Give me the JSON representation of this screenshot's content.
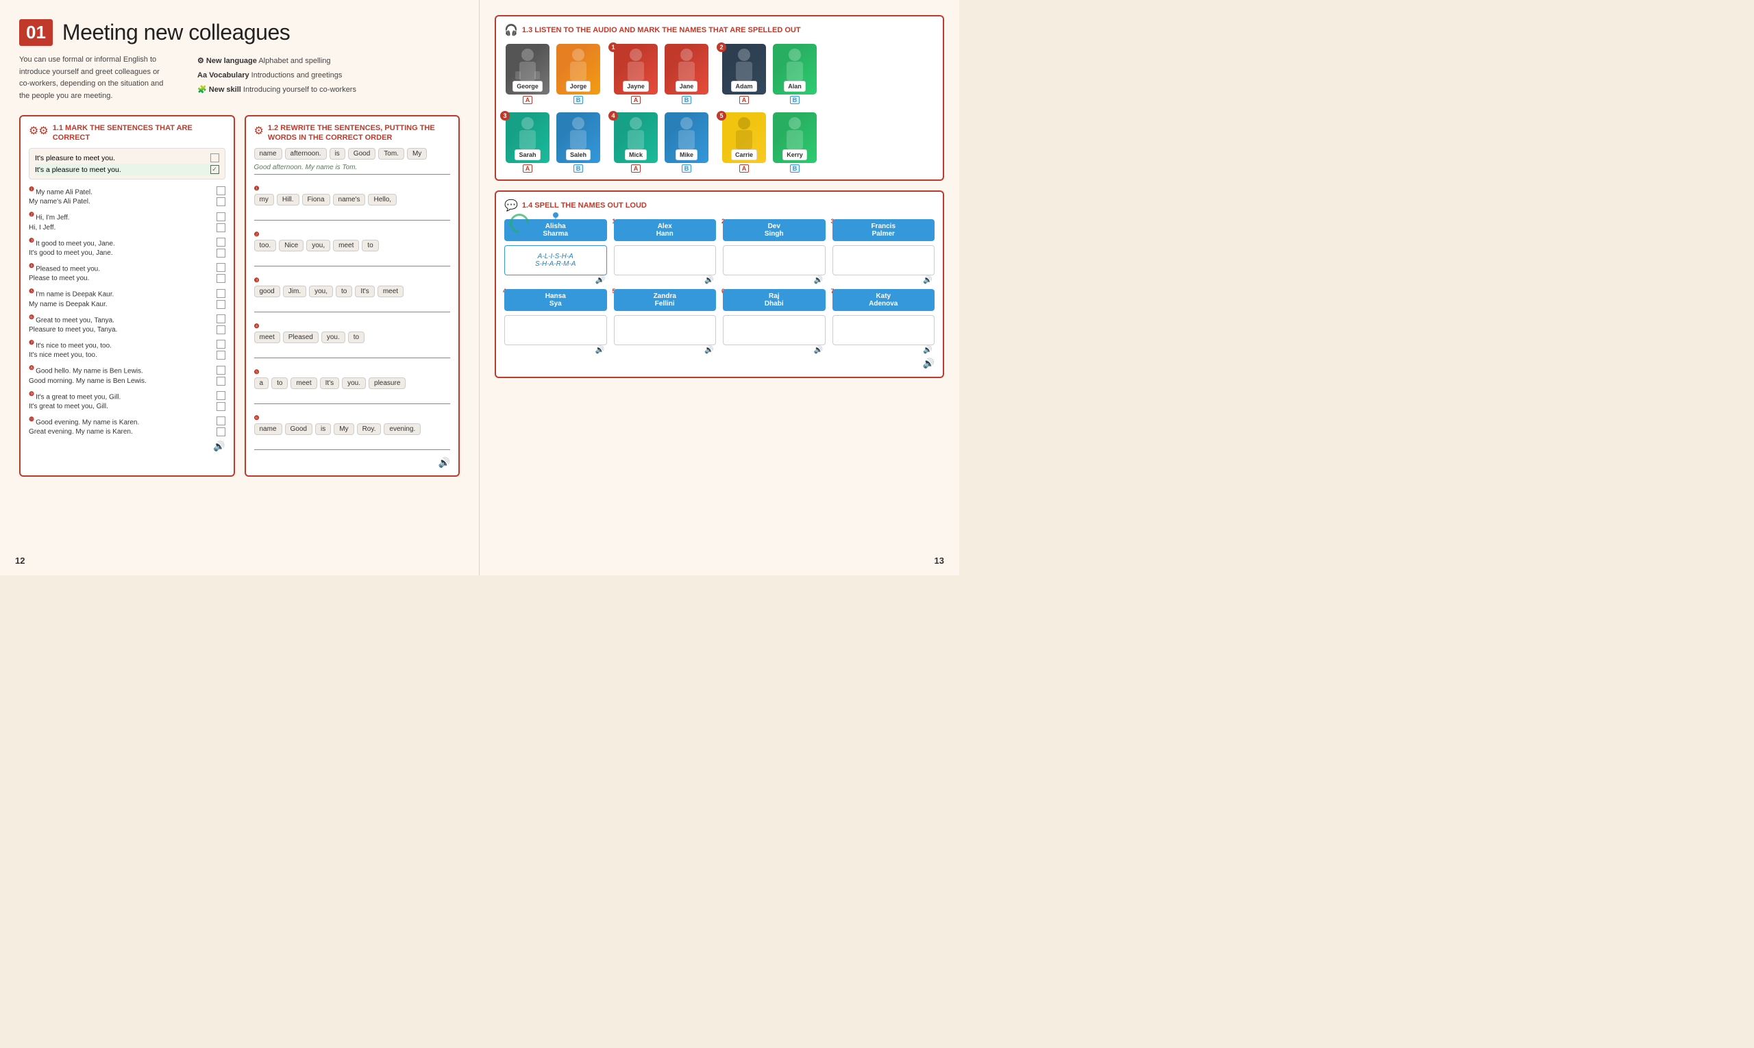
{
  "left": {
    "page_num": "12",
    "lesson_num": "01",
    "lesson_title": "Meeting new colleagues",
    "intro_desc": "You can use formal or informal English to introduce yourself and greet colleagues or co-workers, depending on the situation and the people you are meeting.",
    "skills": [
      {
        "icon": "⚙",
        "label": "New language",
        "detail": "Alphabet and spelling"
      },
      {
        "icon": "Aa",
        "label": "Vocabulary",
        "detail": "Introductions and greetings"
      },
      {
        "icon": "🧩",
        "label": "New skill",
        "detail": "Introducing yourself to co-workers"
      }
    ],
    "ex1": {
      "num": "1.1",
      "title": "MARK THE SENTENCES THAT ARE CORRECT",
      "example_lines": [
        {
          "text": "It's pleasure to meet you.",
          "correct": false
        },
        {
          "text": "It's a pleasure to meet you.",
          "correct": true
        }
      ],
      "pairs": [
        {
          "num": "1",
          "lines": [
            {
              "text": "My name Ali Patel.",
              "correct": false
            },
            {
              "text": "My name's Ali Patel.",
              "correct": false
            }
          ]
        },
        {
          "num": "2",
          "lines": [
            {
              "text": "Hi, I'm Jeff.",
              "correct": false
            },
            {
              "text": "Hi, I Jeff.",
              "correct": false
            }
          ]
        },
        {
          "num": "3",
          "lines": [
            {
              "text": "It good to meet you, Jane.",
              "correct": false
            },
            {
              "text": "It's good to meet you, Jane.",
              "correct": false
            }
          ]
        },
        {
          "num": "4",
          "lines": [
            {
              "text": "Pleased to meet you.",
              "correct": false
            },
            {
              "text": "Please to meet you.",
              "correct": false
            }
          ]
        },
        {
          "num": "5",
          "lines": [
            {
              "text": "I'm name is Deepak Kaur.",
              "correct": false
            },
            {
              "text": "My name is Deepak Kaur.",
              "correct": false
            }
          ]
        },
        {
          "num": "6",
          "lines": [
            {
              "text": "Great to meet you, Tanya.",
              "correct": false
            },
            {
              "text": "Pleasure to meet you, Tanya.",
              "correct": false
            }
          ]
        },
        {
          "num": "7",
          "lines": [
            {
              "text": "It's nice to meet you, too.",
              "correct": false
            },
            {
              "text": "It's nice meet you, too.",
              "correct": false
            }
          ]
        },
        {
          "num": "8",
          "lines": [
            {
              "text": "Good hello. My name is Ben Lewis.",
              "correct": false
            },
            {
              "text": "Good morning. My name is Ben Lewis.",
              "correct": false
            }
          ]
        },
        {
          "num": "9",
          "lines": [
            {
              "text": "It's a great to meet you, Gill.",
              "correct": false
            },
            {
              "text": "It's great to meet you, Gill.",
              "correct": false
            }
          ]
        },
        {
          "num": "10",
          "lines": [
            {
              "text": "Good evening. My name is Karen.",
              "correct": false
            },
            {
              "text": "Great evening. My name is Karen.",
              "correct": false
            }
          ]
        }
      ]
    },
    "ex2": {
      "num": "1.2",
      "title": "REWRITE THE SENTENCES, PUTTING THE WORDS IN THE CORRECT ORDER",
      "example_chips": [
        "name",
        "afternoon.",
        "is",
        "Good",
        "Tom.",
        "My"
      ],
      "example_answer": "Good afternoon. My name is Tom.",
      "rewrites": [
        {
          "num": "1",
          "chips": [
            "my",
            "Hill.",
            "Fiona",
            "name's",
            "Hello,"
          ],
          "answer": ""
        },
        {
          "num": "2",
          "chips": [
            "too.",
            "Nice",
            "you,",
            "meet",
            "to"
          ],
          "answer": ""
        },
        {
          "num": "3",
          "chips": [
            "good",
            "Jim.",
            "you,",
            "to",
            "It's",
            "meet"
          ],
          "answer": ""
        },
        {
          "num": "4",
          "chips": [
            "meet",
            "Pleased",
            "you.",
            "to"
          ],
          "answer": ""
        },
        {
          "num": "5",
          "chips": [
            "a",
            "to",
            "meet",
            "It's",
            "you.",
            "pleasure"
          ],
          "answer": ""
        },
        {
          "num": "6",
          "chips": [
            "name",
            "Good",
            "is",
            "My",
            "Roy.",
            "evening."
          ],
          "answer": ""
        }
      ]
    }
  },
  "right": {
    "page_num": "13",
    "ex3": {
      "num": "1.3",
      "title": "LISTEN TO THE AUDIO AND MARK THE NAMES THAT ARE SPELLED OUT",
      "groups": [
        {
          "num": "",
          "cards": [
            {
              "name": "George",
              "label": "A",
              "bg": "person-bg-dark"
            },
            {
              "name": "Jorge",
              "label": "B",
              "bg": "person-bg-orange"
            }
          ]
        },
        {
          "num": "1",
          "cards": [
            {
              "name": "Jayne",
              "label": "A",
              "bg": "person-bg-red"
            },
            {
              "name": "Jane",
              "label": "B",
              "bg": "person-bg-red"
            }
          ]
        },
        {
          "num": "2",
          "cards": [
            {
              "name": "Adam",
              "label": "A",
              "bg": "person-bg-navy"
            },
            {
              "name": "Alan",
              "label": "B",
              "bg": "person-bg-green"
            }
          ]
        },
        {
          "num": "3",
          "cards": [
            {
              "name": "Sarah",
              "label": "A",
              "bg": "person-bg-teal"
            },
            {
              "name": "Saleh",
              "label": "B",
              "bg": "person-bg-blue"
            }
          ]
        },
        {
          "num": "4",
          "cards": [
            {
              "name": "Mick",
              "label": "A",
              "bg": "person-bg-teal"
            },
            {
              "name": "Mike",
              "label": "B",
              "bg": "person-bg-blue"
            }
          ]
        },
        {
          "num": "5",
          "cards": [
            {
              "name": "Carrie",
              "label": "A",
              "bg": "person-bg-yellow"
            },
            {
              "name": "Kerry",
              "label": "B",
              "bg": "person-bg-green"
            }
          ]
        }
      ]
    },
    "ex4": {
      "num": "1.4",
      "title": "SPELL THE NAMES OUT LOUD",
      "top_cards": [
        {
          "name": "Alisha\nSharma",
          "answer": "A-L-I-S-H-A\nS-H-A-R-M-A",
          "filled": true,
          "num": ""
        },
        {
          "name": "Alex\nHann",
          "answer": "",
          "filled": false,
          "num": "1"
        },
        {
          "name": "Dev\nSingh",
          "answer": "",
          "filled": false,
          "num": "2"
        },
        {
          "name": "Francis\nPalmer",
          "answer": "",
          "filled": false,
          "num": "3"
        }
      ],
      "bottom_cards": [
        {
          "name": "Hansa\nSya",
          "answer": "",
          "filled": false,
          "num": "4"
        },
        {
          "name": "Zandra\nFellini",
          "answer": "",
          "filled": false,
          "num": "5"
        },
        {
          "name": "Raj\nDhabi",
          "answer": "",
          "filled": false,
          "num": "6"
        },
        {
          "name": "Katy\nAdenova",
          "answer": "",
          "filled": false,
          "num": "7"
        }
      ]
    }
  }
}
